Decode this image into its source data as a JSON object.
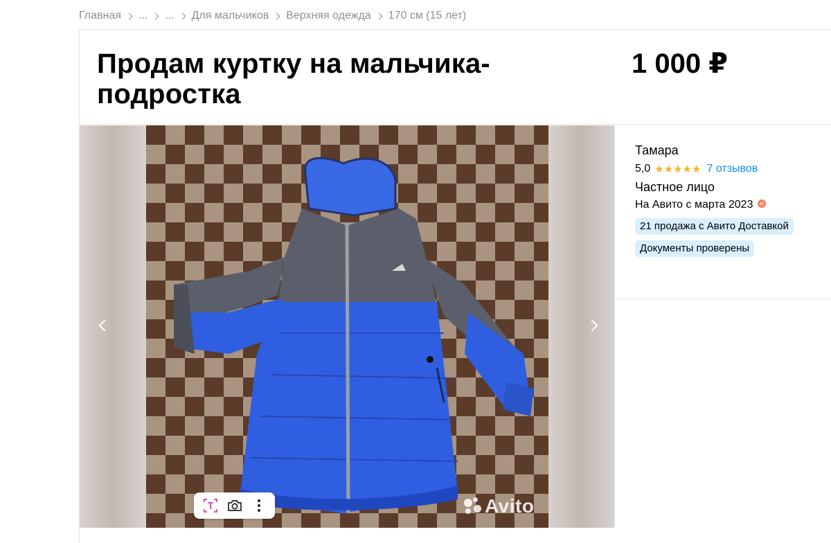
{
  "breadcrumbs": {
    "items": [
      "Главная",
      "...",
      "...",
      "Для мальчиков",
      "Верхняя одежда",
      "170 см (15 лет)"
    ]
  },
  "listing": {
    "title": "Продам куртку на мальчика-подростка",
    "price": "1 000 ₽"
  },
  "gallery": {
    "watermark": "Avito",
    "tools": [
      "text-recognition-icon",
      "camera-search-icon",
      "more-vertical-icon"
    ]
  },
  "seller": {
    "name": "Тамара",
    "rating": "5,0",
    "stars": "★★★★★",
    "reviews": "7 отзывов",
    "type": "Частное лицо",
    "since": "На Авито с марта 2023",
    "badges": [
      "21 продажа с Авито Доставкой",
      "Документы проверены"
    ]
  },
  "colors": {
    "accent_link": "#0a8ff5",
    "star": "#ffb021",
    "badge_bg": "#d9efff",
    "jacket_blue": "#2f5fe0",
    "jacket_grey": "#5a5f6b"
  }
}
